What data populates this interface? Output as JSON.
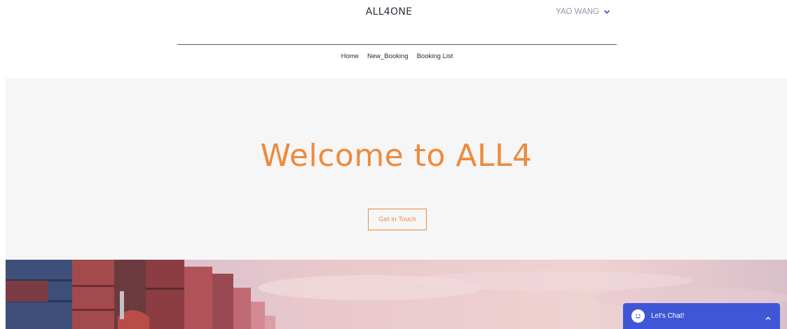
{
  "header": {
    "brand": "ALL4ONE",
    "user_name": "YAO WANG",
    "user_menu_icon": "chevron-down-icon"
  },
  "nav": {
    "items": [
      {
        "label": "Home"
      },
      {
        "label": "New_Booking"
      },
      {
        "label": "Booking List"
      }
    ]
  },
  "hero": {
    "title": "Welcome to ALL4",
    "cta_label": "Get in Touch",
    "accent_color": "#ee8a3c"
  },
  "chat": {
    "label": "Let's Chat!",
    "icon": "smile-face-icon",
    "caret_icon": "chevron-up-icon",
    "color": "#3f57d6"
  }
}
